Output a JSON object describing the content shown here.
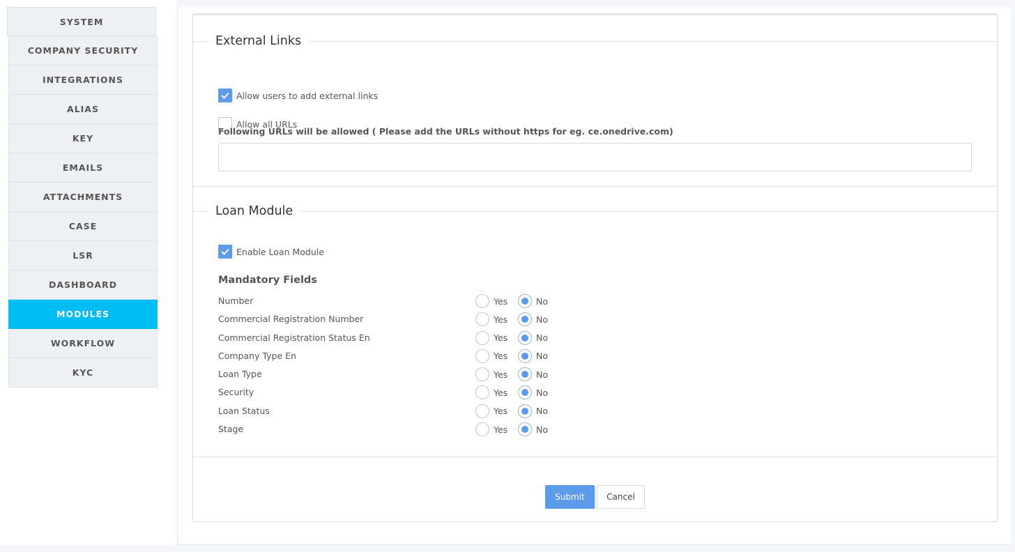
{
  "colors": {
    "accent": "#00bdf2",
    "primary": "#5b9bea",
    "background": "#f5f6fa"
  },
  "sidebar": {
    "items": [
      {
        "label": "SYSTEM",
        "active": false
      },
      {
        "label": "COMPANY SECURITY",
        "active": false
      },
      {
        "label": "INTEGRATIONS",
        "active": false
      },
      {
        "label": "ALIAS",
        "active": false
      },
      {
        "label": "KEY",
        "active": false
      },
      {
        "label": "EMAILS",
        "active": false
      },
      {
        "label": "ATTACHMENTS",
        "active": false
      },
      {
        "label": "CASE",
        "active": false
      },
      {
        "label": "LSR",
        "active": false
      },
      {
        "label": "DASHBOARD",
        "active": false
      },
      {
        "label": "MODULES",
        "active": true
      },
      {
        "label": "WORKFLOW",
        "active": false
      },
      {
        "label": "KYC",
        "active": false
      }
    ]
  },
  "external_links": {
    "legend": "External Links",
    "allow_external": {
      "label": "Allow users to add external links",
      "checked": true
    },
    "allow_all_urls": {
      "label": "Allow all URLs",
      "checked": false
    },
    "hint": "Following URLs will be allowed ( Please add the URLs without https for eg. ce.onedrive.com)",
    "url_value": "",
    "url_placeholder": ""
  },
  "loan_module": {
    "legend": "Loan Module",
    "enable": {
      "label": "Enable Loan Module",
      "checked": true
    },
    "mandatory_title": "Mandatory Fields",
    "yes_label": "Yes",
    "no_label": "No",
    "fields": [
      {
        "label": "Number",
        "value": "No"
      },
      {
        "label": "Commercial Registration Number",
        "value": "No"
      },
      {
        "label": "Commercial Registration Status En",
        "value": "No"
      },
      {
        "label": "Company Type En",
        "value": "No"
      },
      {
        "label": "Loan Type",
        "value": "No"
      },
      {
        "label": "Security",
        "value": "No"
      },
      {
        "label": "Loan Status",
        "value": "No"
      },
      {
        "label": "Stage",
        "value": "No"
      }
    ]
  },
  "actions": {
    "submit_label": "Submit",
    "cancel_label": "Cancel"
  }
}
